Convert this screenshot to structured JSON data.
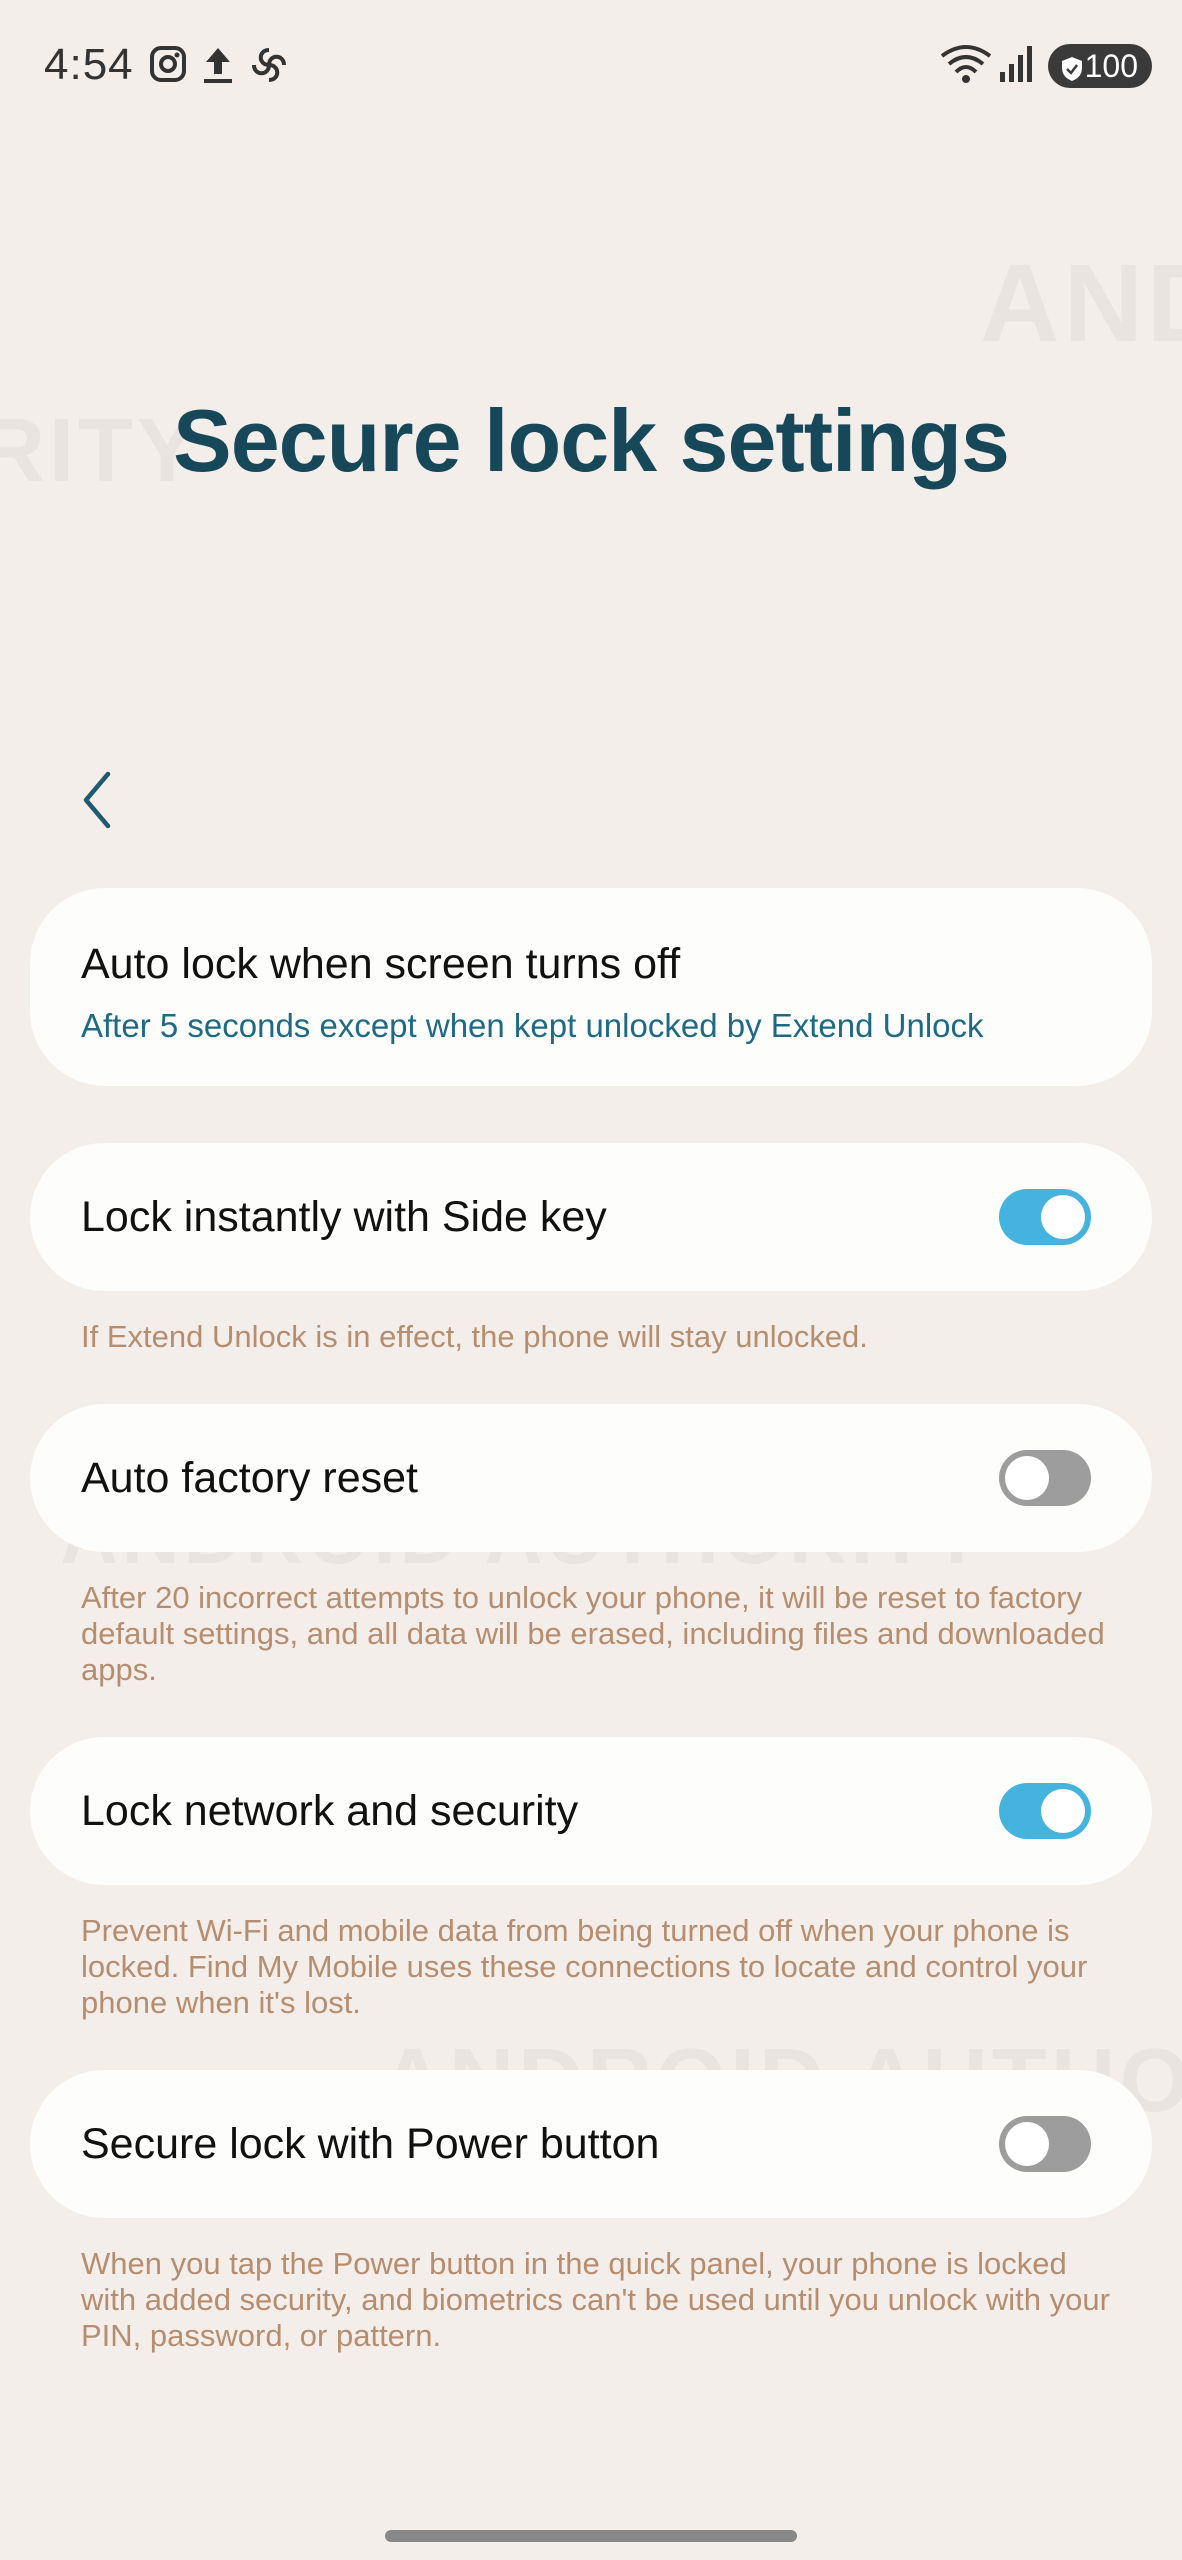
{
  "status_bar": {
    "time": "4:54",
    "battery": "100",
    "icons": [
      "instagram-icon",
      "upload-icon",
      "pinwheel-icon",
      "wifi-icon",
      "signal-icon",
      "battery-shield-icon"
    ]
  },
  "page": {
    "title": "Secure lock settings",
    "back_icon": "chevron-left-icon"
  },
  "settings": [
    {
      "title": "Auto lock when screen turns off",
      "subtitle": "After 5 seconds except when kept unlocked by Extend Unlock"
    },
    {
      "title": "Lock instantly with Side key",
      "toggle": true,
      "description": "If Extend Unlock is in effect, the phone will stay unlocked."
    },
    {
      "title": "Auto factory reset",
      "toggle": false,
      "description": "After 20 incorrect attempts to unlock your phone, it will be reset to factory default settings, and all data will be erased, including files and downloaded apps."
    },
    {
      "title": "Lock network and security",
      "toggle": true,
      "description": "Prevent Wi-Fi and mobile data from being turned off when your phone is locked. Find My Mobile uses these connections to locate and control your phone when it's lost."
    },
    {
      "title": "Secure lock with Power button",
      "toggle": false,
      "description": "When you tap the Power button in the quick panel, your phone is locked with added security, and biometrics can't be used until you unlock with your PIN, password, or pattern."
    }
  ],
  "watermark_text": "ANDROID AUTHORITY",
  "colors": {
    "background": "#f4eeea",
    "title": "#17485a",
    "accent_toggle_on": "#44b4de",
    "toggle_off": "#9d9d9d",
    "description": "#b68e6f",
    "subtitle": "#1e6a84"
  }
}
